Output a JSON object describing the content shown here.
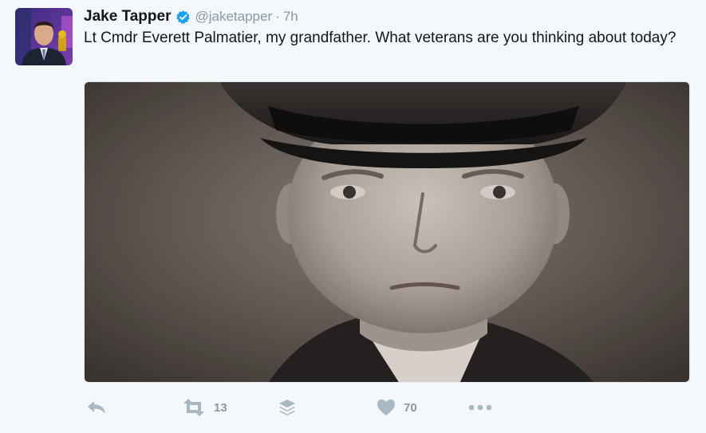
{
  "tweet": {
    "author_name": "Jake Tapper",
    "handle": "@jaketapper",
    "separator": "·",
    "time": "7h",
    "text": "Lt Cmdr Everett Palmatier, my grandfather. What veterans are you thinking about today?"
  },
  "actions": {
    "retweet_count": "13",
    "like_count": "70"
  },
  "icons": {
    "verified": "verified-badge-icon",
    "reply": "reply-icon",
    "retweet": "retweet-icon",
    "stack": "layers-icon",
    "like": "heart-icon",
    "more": "more-icon"
  },
  "colors": {
    "verified_blue": "#1da1f2",
    "action_gray": "#aab8c2",
    "background": "#f5f8fa"
  }
}
